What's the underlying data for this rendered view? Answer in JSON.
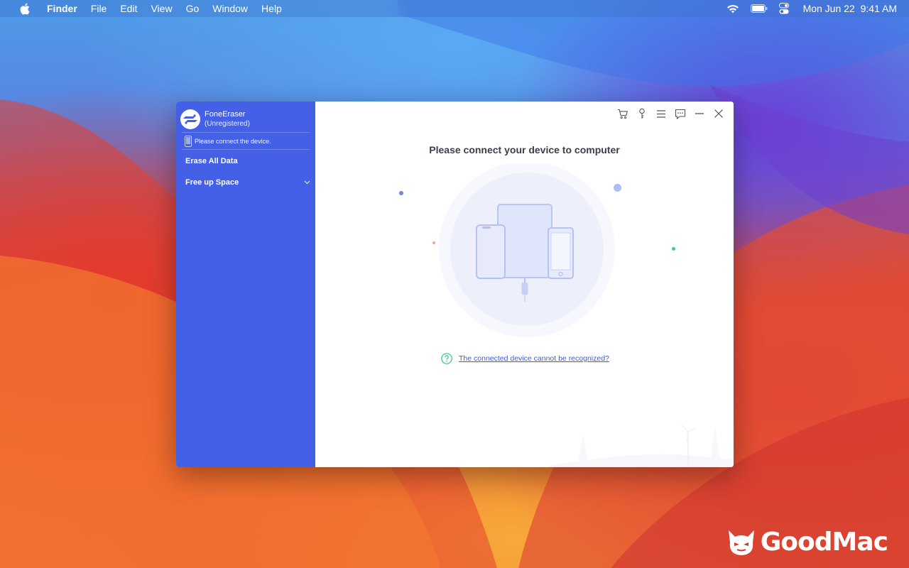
{
  "menubar": {
    "app": "Finder",
    "items": [
      "File",
      "Edit",
      "View",
      "Go",
      "Window",
      "Help"
    ],
    "date": "Mon Jun 22",
    "time": "9:41 AM"
  },
  "app": {
    "name": "FoneEraser",
    "status": "(Unregistered)",
    "device_prompt": "Please connect the device.",
    "nav": [
      {
        "label": "Erase All Data"
      },
      {
        "label": "Free up Space"
      }
    ],
    "heading": "Please connect your device to computer",
    "help_link": "The connected device cannot be recognized?",
    "toolbar_icons": [
      "cart-icon",
      "key-icon",
      "menu-icon",
      "feedback-icon",
      "minimize-icon",
      "close-icon"
    ]
  },
  "watermark": {
    "text": "GoodMac"
  },
  "colors": {
    "sidebar": "#4360e6",
    "accent": "#3b5bd6",
    "help_icon": "#2fc98a"
  }
}
